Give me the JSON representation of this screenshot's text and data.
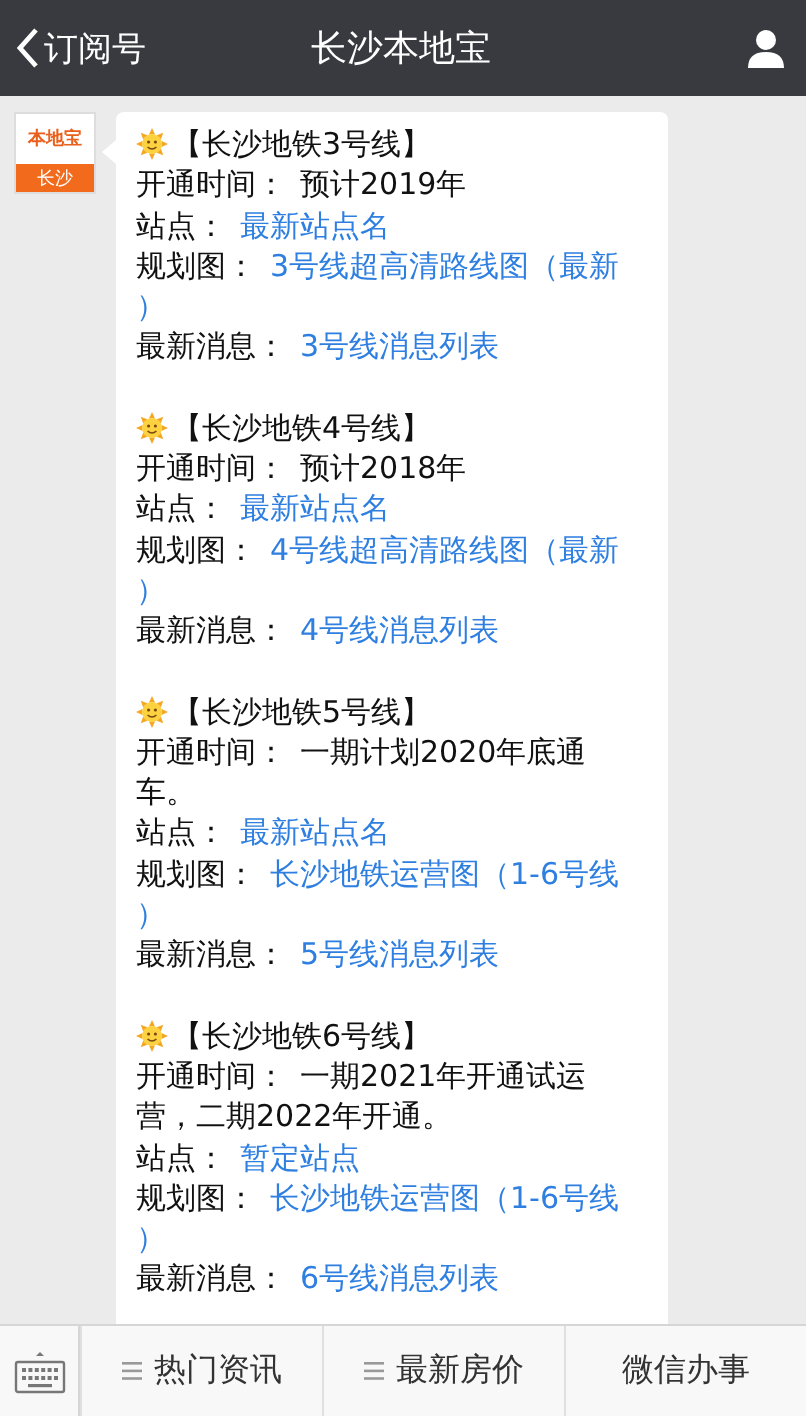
{
  "header": {
    "back_label": "订阅号",
    "title": "长沙本地宝"
  },
  "avatar": {
    "logo": "本地宝",
    "city": "长沙"
  },
  "sections": [
    {
      "title": "【长沙地铁3号线】",
      "lines": [
        {
          "label": "开通时间：",
          "value": "预计2019年",
          "kind": "text"
        },
        {
          "label": "站点：",
          "value": "最新站点名",
          "kind": "link"
        },
        {
          "label": "规划图：",
          "value": "3号线超高清路线图（最新",
          "wrap": "）",
          "kind": "link"
        },
        {
          "label": "最新消息：",
          "value": "3号线消息列表",
          "kind": "link"
        }
      ]
    },
    {
      "title": "【长沙地铁4号线】",
      "lines": [
        {
          "label": "开通时间：",
          "value": "预计2018年",
          "kind": "text"
        },
        {
          "label": "站点：",
          "value": "最新站点名",
          "kind": "link"
        },
        {
          "label": "规划图：",
          "value": "4号线超高清路线图（最新",
          "wrap": "）",
          "kind": "link"
        },
        {
          "label": "最新消息：",
          "value": "4号线消息列表",
          "kind": "link"
        }
      ]
    },
    {
      "title": "【长沙地铁5号线】",
      "lines": [
        {
          "label": "开通时间：",
          "value": "一期计划2020年底通",
          "wrap": "车。",
          "kind": "text"
        },
        {
          "label": "站点：",
          "value": "最新站点名",
          "kind": "link"
        },
        {
          "label": "规划图：",
          "value": "长沙地铁运营图（1-6号线",
          "wrap": "）",
          "kind": "link"
        },
        {
          "label": "最新消息：",
          "value": "5号线消息列表",
          "kind": "link"
        }
      ]
    },
    {
      "title": "【长沙地铁6号线】",
      "lines": [
        {
          "label": "开通时间：",
          "value": "一期2021年开通试运",
          "wrap": "营，二期2022年开通。",
          "kind": "text"
        },
        {
          "label": "站点：",
          "value": "暂定站点",
          "kind": "link"
        },
        {
          "label": "规划图：",
          "value": "长沙地铁运营图（1-6号线",
          "wrap": "）",
          "kind": "link"
        },
        {
          "label": "最新消息：",
          "value": "6号线消息列表",
          "kind": "link"
        }
      ]
    }
  ],
  "menu": [
    {
      "label": "热门资讯",
      "has_submenu": true
    },
    {
      "label": "最新房价",
      "has_submenu": true
    },
    {
      "label": "微信办事",
      "has_submenu": false
    }
  ]
}
